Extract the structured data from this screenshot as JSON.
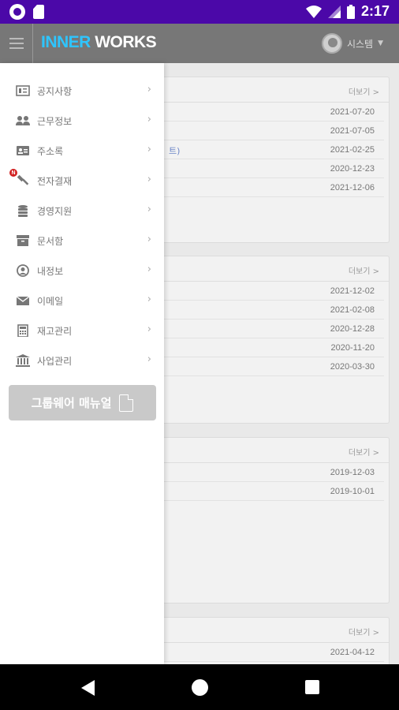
{
  "status": {
    "time": "2:17"
  },
  "appbar": {
    "logo_part1": "INNER",
    "logo_part2": "WORKS",
    "user_name": "시스템"
  },
  "drawer": {
    "items": [
      {
        "label": "공지사항",
        "icon": "notice-icon"
      },
      {
        "label": "근무정보",
        "icon": "group-icon"
      },
      {
        "label": "주소록",
        "icon": "contact-card-icon"
      },
      {
        "label": "전자결재",
        "icon": "gavel-icon",
        "badge": "N"
      },
      {
        "label": "경영지원",
        "icon": "database-icon"
      },
      {
        "label": "문서함",
        "icon": "archive-icon"
      },
      {
        "label": "내정보",
        "icon": "user-circle-icon"
      },
      {
        "label": "이메일",
        "icon": "mail-icon"
      },
      {
        "label": "재고관리",
        "icon": "calculator-icon"
      },
      {
        "label": "사업관리",
        "icon": "bank-icon"
      }
    ],
    "manual_button": "그룹웨어 매뉴얼"
  },
  "background": {
    "more_label": "더보기 >",
    "card1": {
      "dates": [
        "2021-07-20",
        "2021-07-05",
        "2021-02-25",
        "2020-12-23",
        "2021-12-06"
      ],
      "fragment": "트)"
    },
    "card2": {
      "dates": [
        "2021-12-02",
        "2021-02-08",
        "2020-12-28",
        "2020-11-20",
        "2020-03-30"
      ]
    },
    "card3": {
      "dates": [
        "2019-12-03",
        "2019-10-01"
      ]
    },
    "card4": {
      "dates": [
        "2021-04-12"
      ]
    }
  }
}
